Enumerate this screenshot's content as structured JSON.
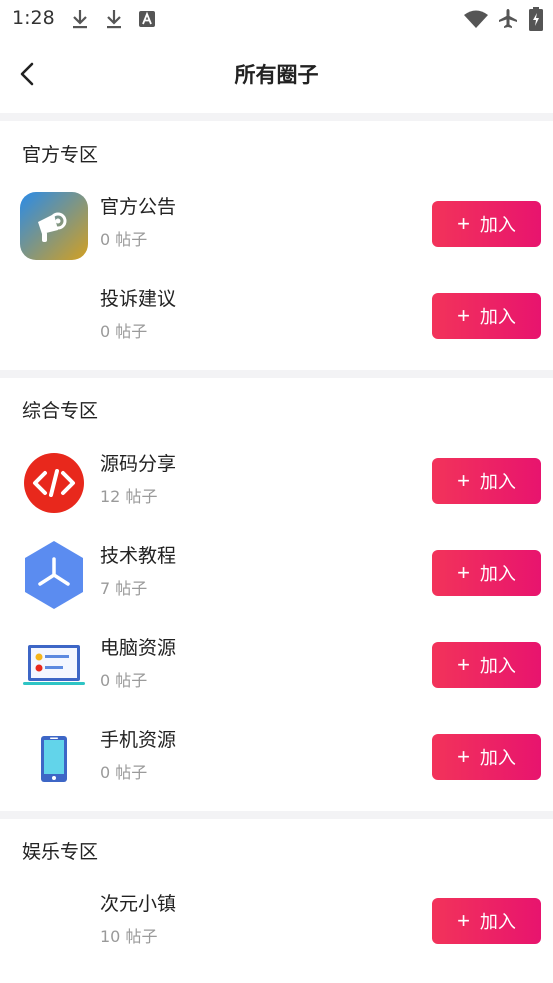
{
  "status_bar": {
    "time": "1:28"
  },
  "header": {
    "title": "所有圈子"
  },
  "join_label": "加入",
  "count_suffix": "帖子",
  "sections": [
    {
      "title": "官方专区",
      "items": [
        {
          "name": "官方公告",
          "count": "0",
          "icon": "megaphone-icon"
        },
        {
          "name": "投诉建议",
          "count": "0",
          "icon": ""
        }
      ]
    },
    {
      "title": "综合专区",
      "items": [
        {
          "name": "源码分享",
          "count": "12",
          "icon": "code-icon"
        },
        {
          "name": "技术教程",
          "count": "7",
          "icon": "hexagon-icon"
        },
        {
          "name": "电脑资源",
          "count": "0",
          "icon": "computer-icon"
        },
        {
          "name": "手机资源",
          "count": "0",
          "icon": "phone-icon"
        }
      ]
    },
    {
      "title": "娱乐专区",
      "items": [
        {
          "name": "次元小镇",
          "count": "10",
          "icon": ""
        }
      ]
    }
  ]
}
